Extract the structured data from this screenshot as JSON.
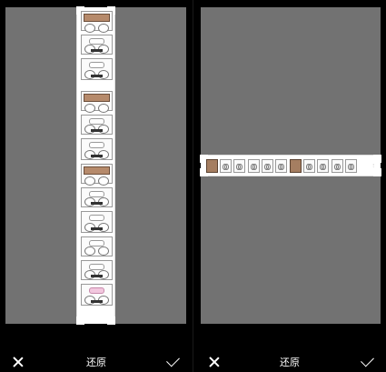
{
  "toolbar": {
    "left": {
      "cancel_icon": "close-icon",
      "reset_label": "还原",
      "confirm_icon": "checkmark-icon"
    },
    "right": {
      "cancel_icon": "close-icon",
      "reset_label": "还原",
      "confirm_icon": "checkmark-icon"
    }
  },
  "colors": {
    "background": "#000000",
    "canvas": "#727272",
    "image_bg": "#ffffff"
  }
}
